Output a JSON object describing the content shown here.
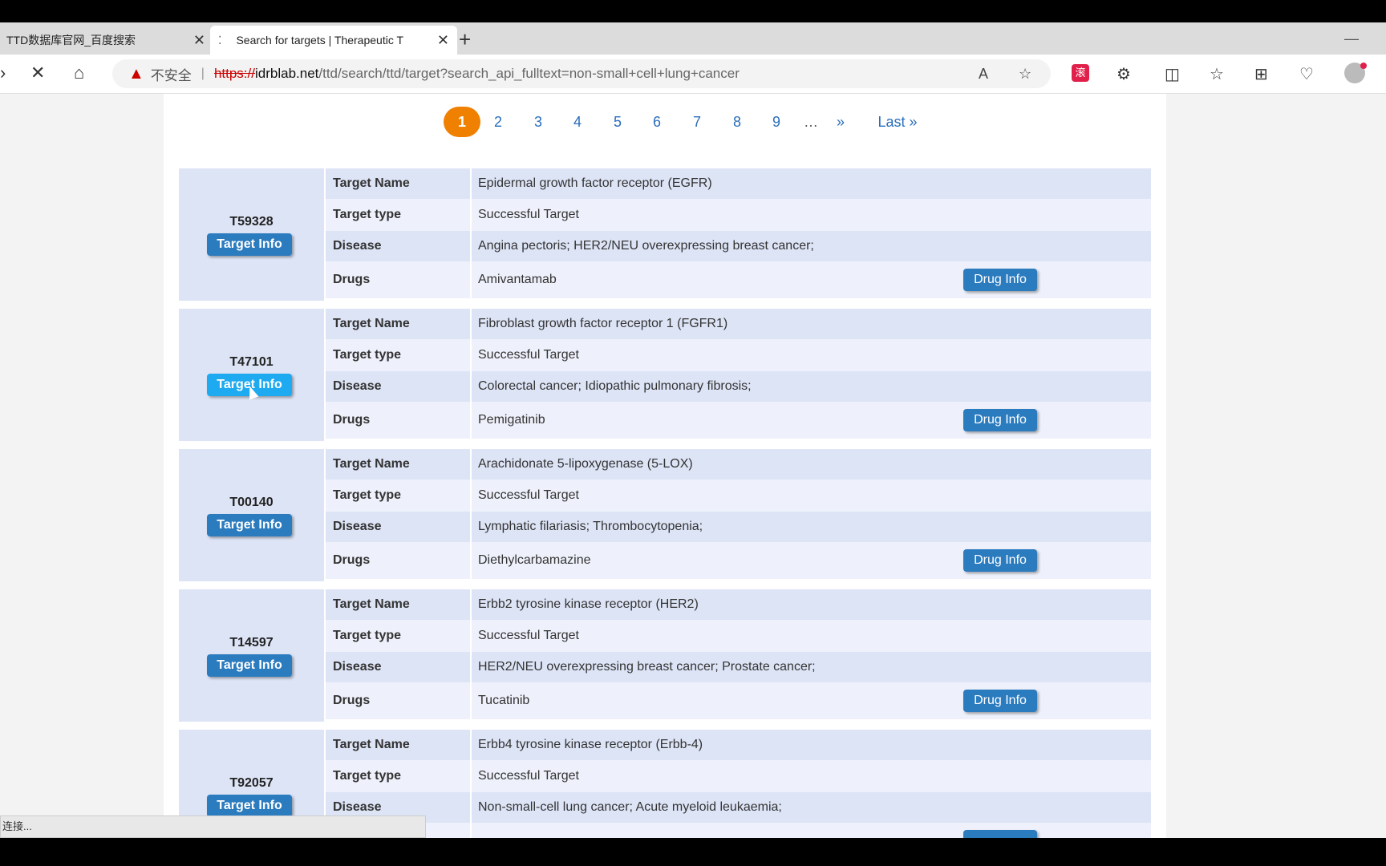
{
  "browser": {
    "tabs": [
      {
        "label": "TTD数据库官网_百度搜索"
      },
      {
        "label": "Search for targets | Therapeutic T"
      }
    ],
    "new_tab": "+",
    "insecure_label": "不安全",
    "url_scheme": "https://",
    "url_host": "idrblab.net",
    "url_path": "/ttd/search/ttd/target?search_api_fulltext=non-small+cell+lung+cancer",
    "ext_badge": "滚"
  },
  "pager": {
    "pages": [
      "1",
      "2",
      "3",
      "4",
      "5",
      "6",
      "7",
      "8",
      "9"
    ],
    "ellipsis": "…",
    "next": "»",
    "last": "Last »"
  },
  "labels": {
    "target_name": "Target Name",
    "target_type": "Target type",
    "disease": "Disease",
    "drugs": "Drugs",
    "target_info_btn": "Target Info",
    "drug_info_btn": "Drug Info"
  },
  "records": [
    {
      "id": "T59328",
      "name": "Epidermal growth factor receptor (EGFR)",
      "type": "Successful Target",
      "disease": "Angina pectoris; HER2/NEU overexpressing breast cancer;",
      "drug": "Amivantamab"
    },
    {
      "id": "T47101",
      "name": "Fibroblast growth factor receptor 1 (FGFR1)",
      "type": "Successful Target",
      "disease": "Colorectal cancer; Idiopathic pulmonary fibrosis;",
      "drug": "Pemigatinib"
    },
    {
      "id": "T00140",
      "name": "Arachidonate 5-lipoxygenase (5-LOX)",
      "type": "Successful Target",
      "disease": "Lymphatic filariasis; Thrombocytopenia;",
      "drug": "Diethylcarbamazine"
    },
    {
      "id": "T14597",
      "name": "Erbb2 tyrosine kinase receptor (HER2)",
      "type": "Successful Target",
      "disease": "HER2/NEU overexpressing breast cancer; Prostate cancer;",
      "drug": "Tucatinib"
    },
    {
      "id": "T92057",
      "name": "Erbb4 tyrosine kinase receptor (Erbb-4)",
      "type": "Successful Target",
      "disease": "Non-small-cell lung cancer; Acute myeloid leukaemia;",
      "drug": ""
    }
  ],
  "status_bar": "连接..."
}
